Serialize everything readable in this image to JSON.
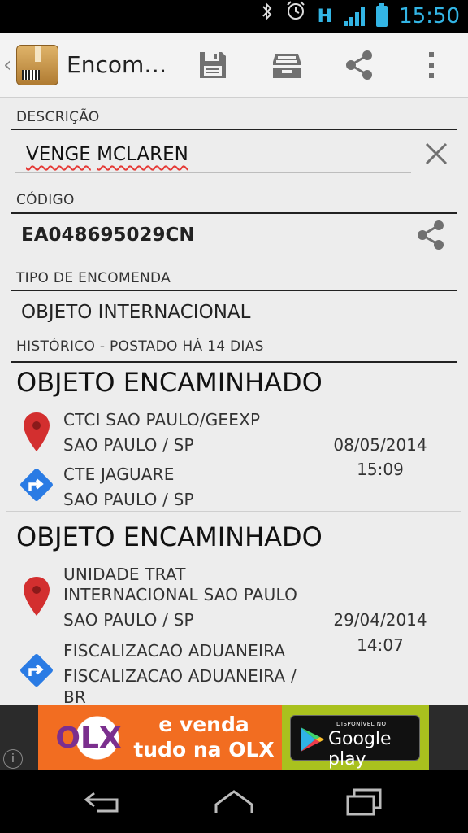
{
  "status_bar": {
    "time": "15:50",
    "network": "H",
    "icons": [
      "bluetooth-icon",
      "alarm-icon",
      "network-h-icon",
      "signal-icon",
      "battery-icon"
    ],
    "accent": "#33b5e5"
  },
  "action_bar": {
    "title": "Encom…",
    "actions": [
      "save-icon",
      "archive-icon",
      "share-icon",
      "overflow-menu-icon"
    ]
  },
  "form": {
    "descricao_label": "DESCRIÇÃO",
    "descricao_word1": "VENGE",
    "descricao_word2": "MCLAREN",
    "codigo_label": "CÓDIGO",
    "codigo_value": "EA048695029CN",
    "tipo_label": "TIPO DE ENCOMENDA",
    "tipo_value": "OBJETO INTERNACIONAL",
    "historico_label": "HISTÓRICO - POSTADO HÁ 14 DIAS"
  },
  "history": [
    {
      "title": "OBJETO ENCAMINHADO",
      "origin_line1": "CTCI SAO PAULO/GEEXP",
      "origin_line2": "SAO PAULO / SP",
      "date": "08/05/2014",
      "time": "15:09",
      "dest_line1": "CTE JAGUARE",
      "dest_line2": "SAO PAULO / SP"
    },
    {
      "title": "OBJETO ENCAMINHADO",
      "origin_line1": "UNIDADE TRAT",
      "origin_line2": "INTERNACIONAL SAO PAULO",
      "origin_line3": "SAO PAULO / SP",
      "date": "29/04/2014",
      "time": "14:07",
      "dest_line1": "FISCALIZACAO ADUANEIRA",
      "dest_line2": "FISCALIZACAO ADUANEIRA /",
      "dest_line3": "BR"
    }
  ],
  "ad": {
    "logo": "OLX",
    "text_line1": "e venda",
    "text_line2": "tudo na OLX",
    "badge_small": "DISPONÍVEL NO",
    "badge_text": "Google play",
    "colors": {
      "orange": "#f26d21",
      "green": "#a9c11e"
    }
  },
  "nav_bar": {
    "buttons": [
      "back-icon",
      "home-icon",
      "recents-icon"
    ]
  },
  "colors": {
    "pin_red": "#d32f2f",
    "direction_blue": "#2a7be4",
    "background": "#ededed"
  }
}
